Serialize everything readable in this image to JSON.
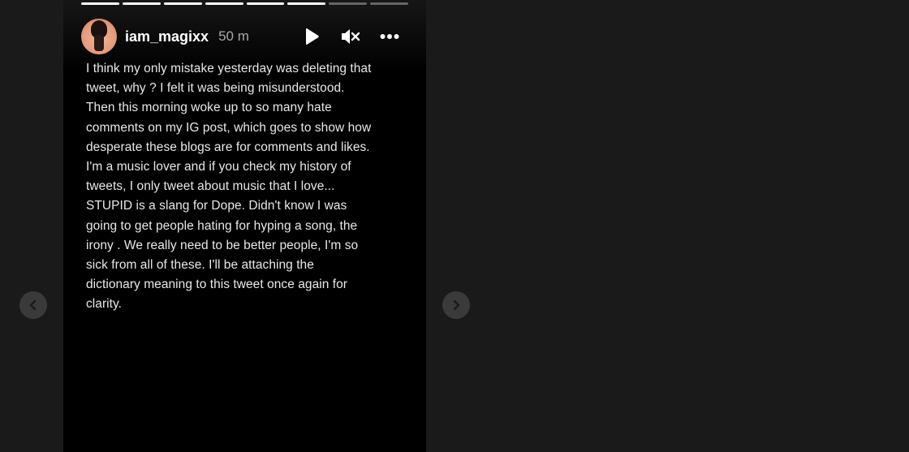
{
  "story": {
    "progress": {
      "segments_total": 8,
      "segments_done": 6
    },
    "author": {
      "username": "iam_magixx",
      "time_ago": "50 m",
      "avatar_icon": "profile-avatar"
    },
    "controls": {
      "play_icon": "play-icon",
      "mute_icon": "muted-speaker-icon",
      "more_icon": "more-options-icon"
    },
    "text": "I think my only mistake yesterday was deleting that\ntweet, why ? I felt it was being misunderstood.\nThen this morning woke up to so many hate\ncomments on my IG post, which goes to show how\ndesperate these blogs are for comments and likes.\nI'm a music lover and if you check my history of\ntweets, I only tweet about music that I love...\nSTUPID is a slang for Dope. Didn't know I was\ngoing to get people hating for hyping a song, the\nirony . We really need to be better people, I'm so\nsick from all of these. I'll be attaching the\ndictionary meaning to this tweet once again for\nclarity."
  },
  "navigation": {
    "prev_icon": "chevron-left-icon",
    "next_icon": "chevron-right-icon"
  },
  "colors": {
    "page_background": "#1a1a1a",
    "card_background": "#000000",
    "text_primary": "#ffffff",
    "text_secondary": "#a8a8a8",
    "nav_button": "#3a3a3a"
  }
}
